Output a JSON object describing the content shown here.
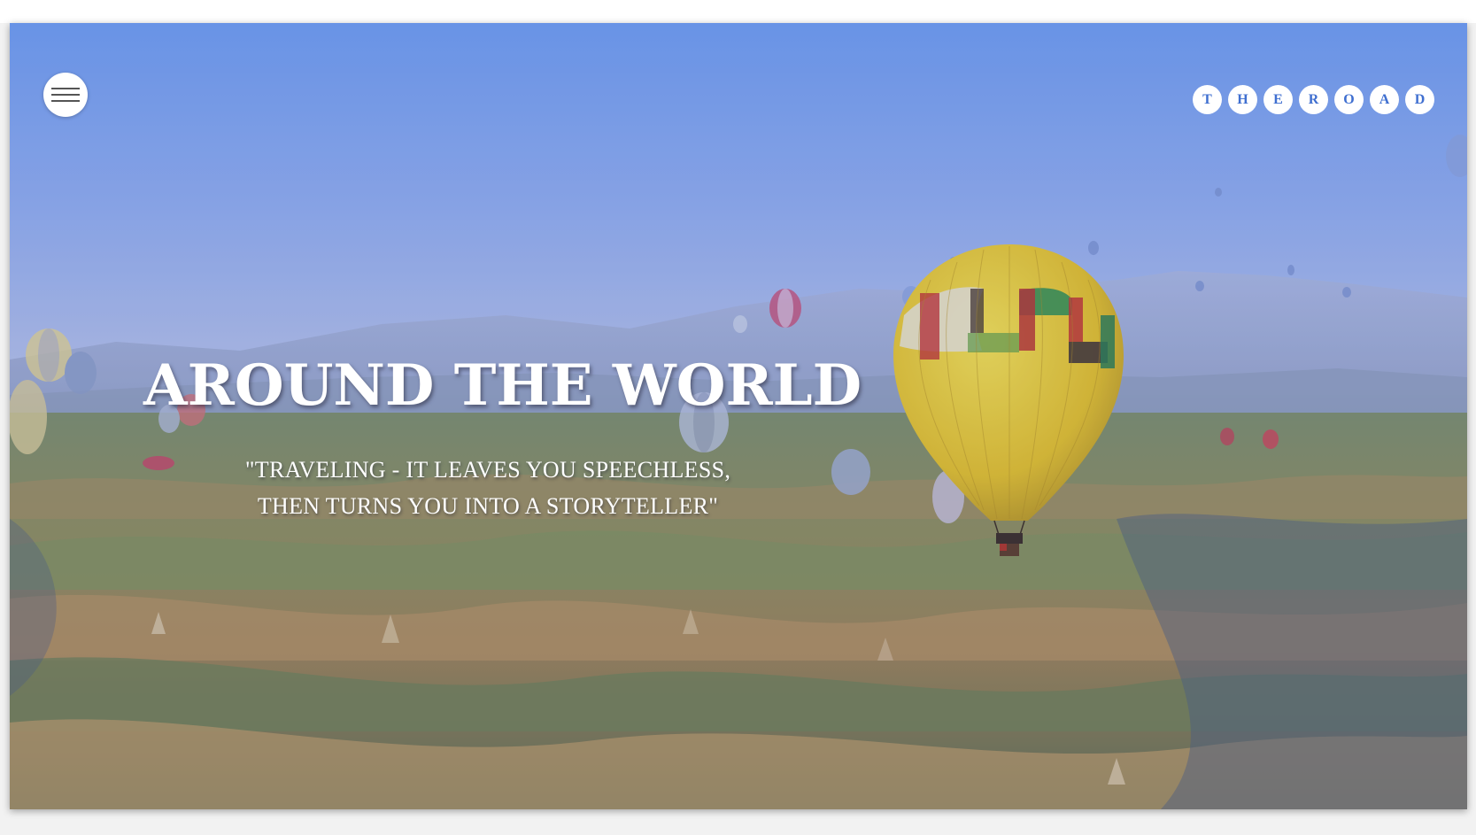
{
  "header": {
    "menu_icon": "hamburger-menu-icon",
    "logo_letters": [
      "T",
      "H",
      "E",
      "R",
      "O",
      "A",
      "D"
    ]
  },
  "hero": {
    "title": "AROUND THE WORLD",
    "quote_line1": "\"TRAVELING - IT LEAVES YOU SPEECHLESS,",
    "quote_line2": "THEN TURNS YOU INTO A STORYTELLER\"",
    "background_image": "hot-air-balloons-over-cappadocia-landscape"
  },
  "colors": {
    "sky_top": "#6f9be8",
    "logo_text": "#3f6fd0",
    "balloon_main": "#e8c62a",
    "title_text": "#ffffff"
  }
}
